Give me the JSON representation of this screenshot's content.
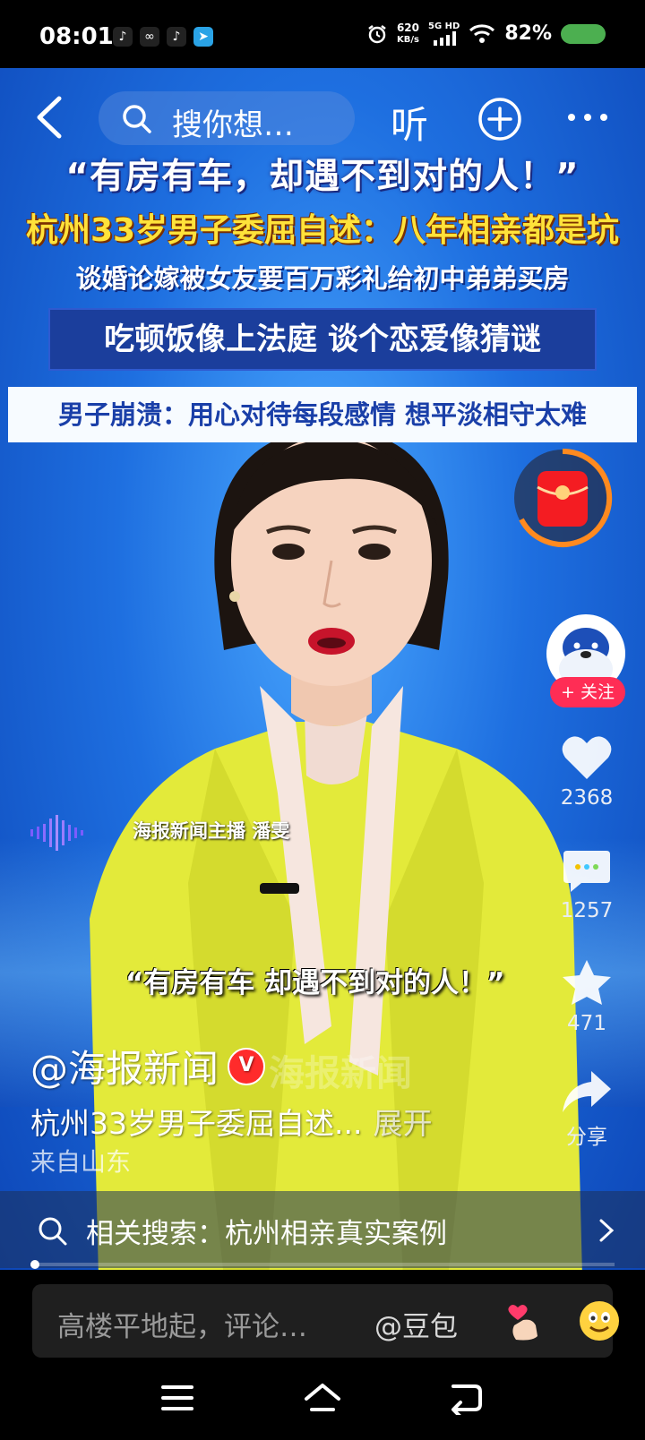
{
  "status_bar": {
    "time": "08:01",
    "net_speed_value": "620",
    "net_speed_unit": "KB/s",
    "network_type": "5G HD",
    "battery_percent": "82%",
    "app_icons": [
      "tiktok-icon",
      "link-icon",
      "tiktok-icon",
      "telegram-icon"
    ]
  },
  "topnav": {
    "search_placeholder": "搜你想…",
    "listen_label": "听"
  },
  "headline": {
    "line1": "“有房有车，却遇不到对的人！”",
    "line2": "杭州33岁男子委屈自述：八年相亲都是坑",
    "line3": "谈婚论嫁被女友要百万彩礼给初中弟弟买房",
    "line4": "吃顿饭像上法庭 谈个恋爱像猜谜",
    "line5": "男子崩溃：用心对待每段感情 想平淡相守太难"
  },
  "captions": {
    "host": "海报新闻主播 潘雯",
    "quote": "“有房有车 却遇不到对的人！”"
  },
  "sidebar": {
    "follow_label": "+ 关注",
    "likes": "2368",
    "comments": "1257",
    "favorites": "471",
    "share_label": "分享"
  },
  "video_info": {
    "author": "@海报新闻",
    "verified_mark": "V",
    "description": "杭州33岁男子委屈自述...",
    "expand_label": "展开",
    "location": "来自山东"
  },
  "related_search": {
    "text": "相关搜索：杭州相亲真实案例"
  },
  "comment_bar": {
    "placeholder": "高楼平地起，评论…",
    "mention": "@豆包"
  },
  "colors": {
    "accent_red": "#ff2d55",
    "headline_yellow": "#ffe23a",
    "blazer_yellow": "#e8ee3c"
  }
}
